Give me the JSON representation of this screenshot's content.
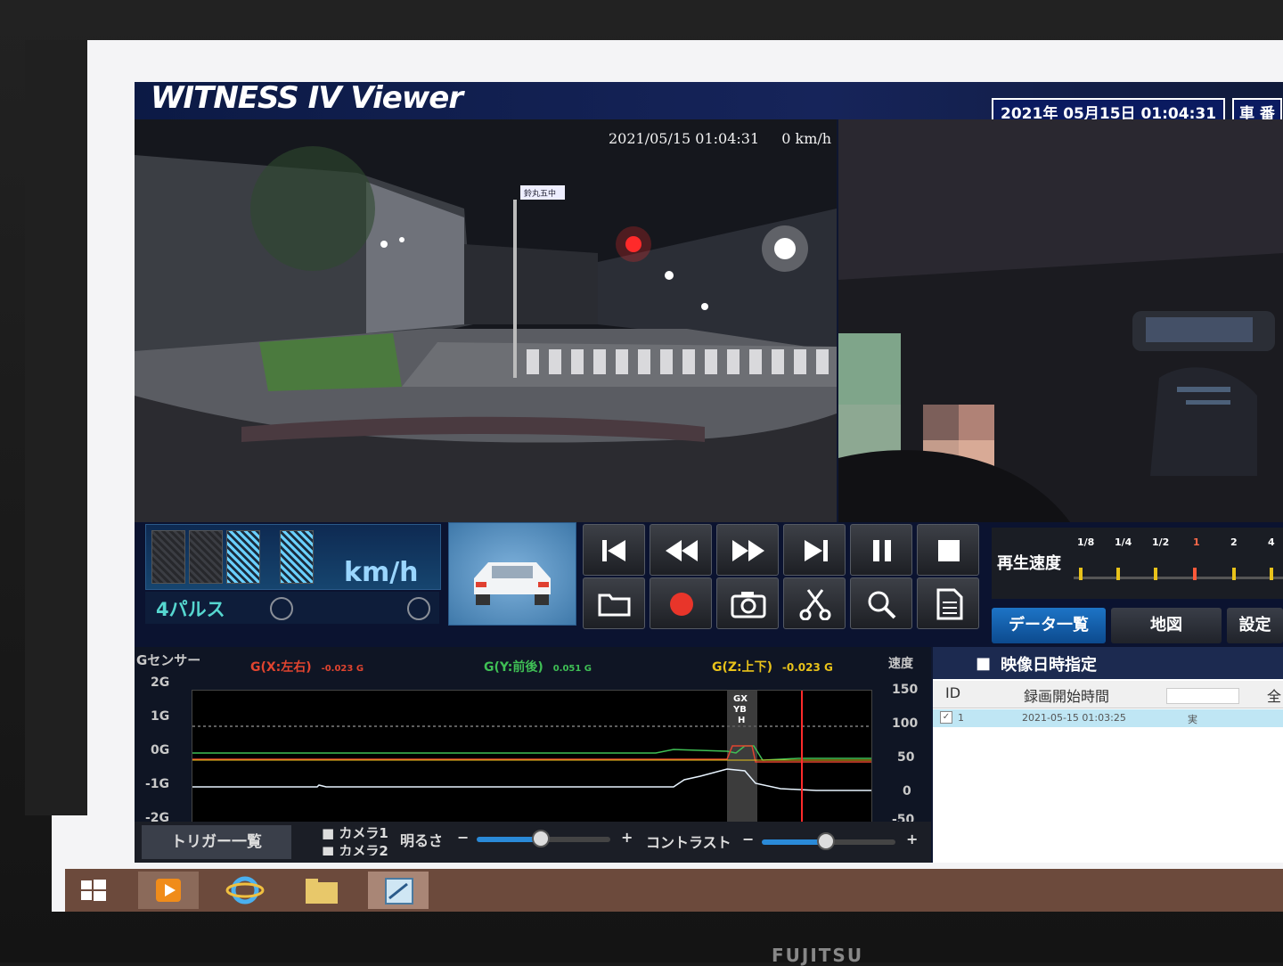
{
  "app": {
    "title": "WITNESS IV Viewer",
    "datetime": "2021年 05月15日 01:04:31",
    "vehicle_no_label": "車 番"
  },
  "video": {
    "osd_datetime": "2021/05/15 01:04:31",
    "osd_speed": "0 km/h",
    "sign_text": "鈴丸五中"
  },
  "speed_panel": {
    "unit": "km/h",
    "pulse_label": "4パルス"
  },
  "playback": {
    "speed_label": "再生速度",
    "rates": [
      "1/8",
      "1/4",
      "1/2",
      "1",
      "2",
      "4"
    ],
    "current_rate": "1"
  },
  "tabs": {
    "data_list": "データ一覧",
    "map": "地図",
    "settings": "設定"
  },
  "gsensor": {
    "title": "Gセンサー",
    "x_label": "G(X:左右)",
    "x_value": "-0.023 G",
    "y_label": "G(Y:前後)",
    "y_value": "0.051 G",
    "z_label": "G(Z:上下)",
    "z_value": "-0.023 G",
    "speed_axis_title": "速度",
    "left_ticks": [
      "2G",
      "1G",
      "0G",
      "-1G",
      "-2G"
    ],
    "right_ticks": [
      "150",
      "100",
      "50",
      "0",
      "-50"
    ],
    "marker_text": [
      "GX",
      "YB",
      "H"
    ],
    "colors": {
      "x": "#e0442f",
      "y": "#3fbf55",
      "z": "#e8c21a",
      "speed": "#ffffff"
    }
  },
  "bottom": {
    "trigger_list": "トリガー一覧",
    "camera1": "カメラ1",
    "camera2": "カメラ2",
    "brightness": "明るさ",
    "contrast": "コントラスト",
    "minus": "−",
    "plus": "+"
  },
  "data_panel": {
    "header": "映像日時指定",
    "col_id": "ID",
    "col_start": "録画開始時間",
    "col_extra": "全",
    "row": {
      "id": "1",
      "start": "2021-05-15 01:03:25",
      "type": "実"
    }
  },
  "bezel": {
    "brand": "FUJITSU"
  }
}
